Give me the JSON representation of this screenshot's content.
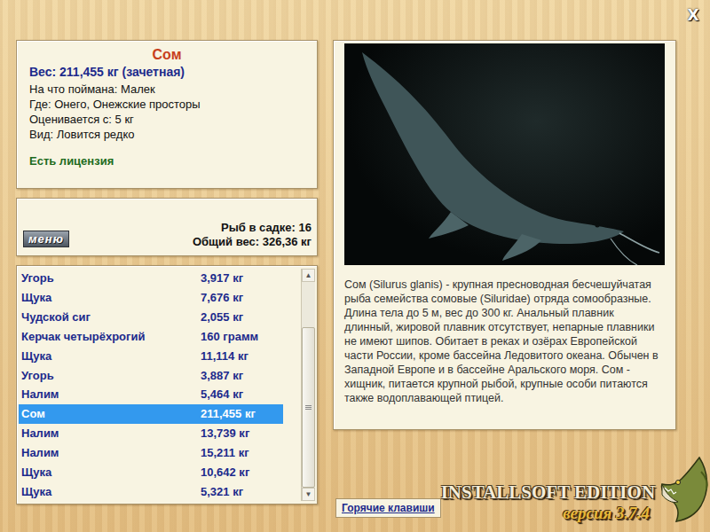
{
  "close": "X",
  "catch": {
    "title": "Сом",
    "weight": "Вес: 211,455 кг (зачетная)",
    "details": [
      "На что поймана: Малек",
      "Где: Онего, Онежские просторы",
      "Оценивается с: 5 кг",
      "Вид: Ловится редко"
    ],
    "license": "Есть лицензия"
  },
  "menu_button": "меню",
  "keepnet": {
    "count": "Рыб в садке: 16",
    "total": "Общий вес: 326,36 кг"
  },
  "fish_list": [
    {
      "name": "Угорь",
      "weight": "3,917 кг",
      "selected": false
    },
    {
      "name": "Щука",
      "weight": "7,676 кг",
      "selected": false
    },
    {
      "name": "Чудской сиг",
      "weight": "2,055 кг",
      "selected": false
    },
    {
      "name": "Керчак четырёхрогий",
      "weight": "160 грамм",
      "selected": false
    },
    {
      "name": "Щука",
      "weight": "11,114 кг",
      "selected": false
    },
    {
      "name": "Угорь",
      "weight": "3,887 кг",
      "selected": false
    },
    {
      "name": "Налим",
      "weight": "5,464 кг",
      "selected": false
    },
    {
      "name": "Сом",
      "weight": "211,455 кг",
      "selected": true
    },
    {
      "name": "Налим",
      "weight": "13,739 кг",
      "selected": false
    },
    {
      "name": "Налим",
      "weight": "15,211 кг",
      "selected": false
    },
    {
      "name": "Щука",
      "weight": "10,642 кг",
      "selected": false
    },
    {
      "name": "Щука",
      "weight": "5,321 кг",
      "selected": false
    }
  ],
  "scrollbar": {
    "level": 0.78
  },
  "description": "Сом (Silurus glanis) - крупная пресноводная бесчешуйчатая рыба семейства сомовые (Siluridae) отряда сомообразные. Длина тела до 5 м, вес до 300 кг. Анальный плавник длинный, жировой плавник отсутствует, непарные плавники не имеют шипов. Обитает в реках и озёрах Европейской части России, кроме бассейна Ледовитого океана. Обычен в Западной Европе и в бассейне Аральского моря. Сом - хищник, питается крупной рыбой, крупные особи питаются также водоплавающей птицей.",
  "hotkeys_button": "Горячие клавиши",
  "logo": {
    "title": "INSTALLSOFT EDITION",
    "version": "версия 3.7.4"
  }
}
